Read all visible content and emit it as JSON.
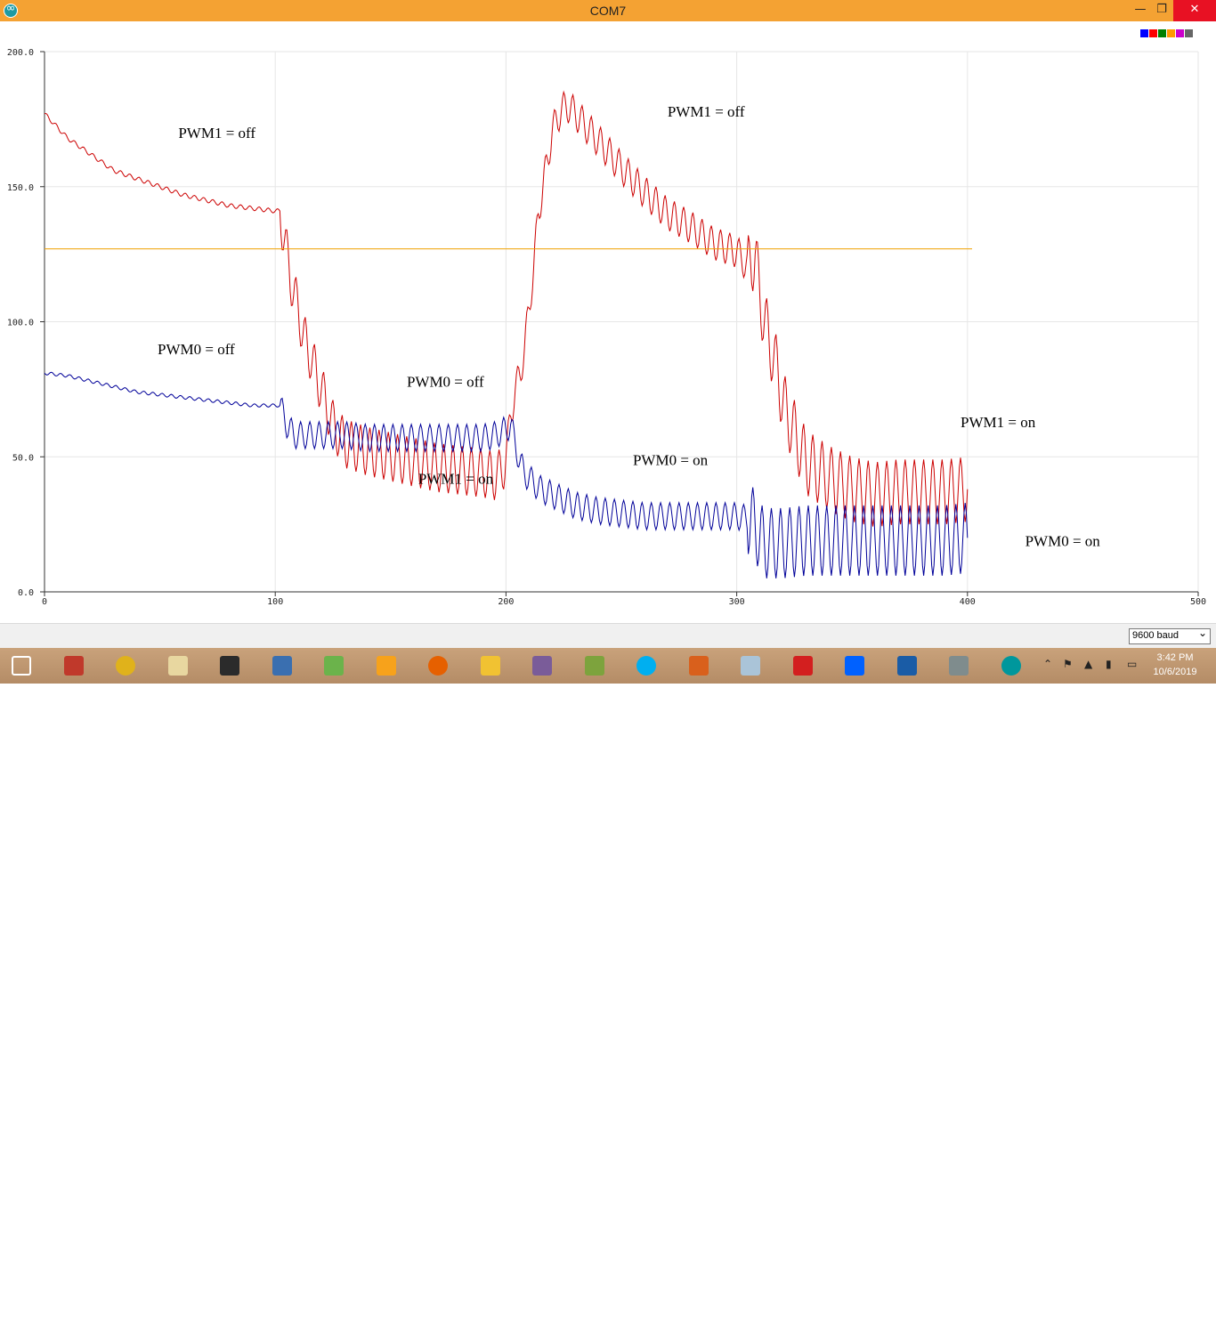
{
  "window": {
    "title": "COM7",
    "minimize": "—",
    "restore": "❐",
    "close": "✕"
  },
  "chart_data": {
    "type": "line",
    "xlim": [
      0,
      500
    ],
    "ylim": [
      0,
      200
    ],
    "xticks": [
      "0",
      "100",
      "200",
      "300",
      "400",
      "500"
    ],
    "yticks": [
      "0.0",
      "50.0",
      "100.0",
      "150.0",
      "200.0"
    ],
    "grid": true,
    "legend": "top-right",
    "colors": [
      "#0000ff",
      "#ff0000",
      "#008000",
      "#ff9900",
      "#cc00cc",
      "#666666"
    ],
    "series": [
      {
        "color": "#cc0000",
        "x": [
          0,
          10,
          20,
          30,
          40,
          50,
          60,
          70,
          80,
          90,
          100,
          102,
          105,
          108,
          110,
          112,
          115,
          118,
          120,
          125,
          130,
          140,
          150,
          160,
          170,
          180,
          190,
          195,
          198,
          200,
          202,
          204,
          206,
          208,
          210,
          212,
          214,
          216,
          218,
          220,
          222,
          224,
          226,
          228,
          230,
          235,
          240,
          250,
          260,
          270,
          280,
          290,
          300,
          305,
          308,
          310,
          312,
          315,
          318,
          320,
          330,
          340,
          350,
          360,
          370,
          380,
          390,
          400
        ],
        "y": [
          177,
          168,
          162,
          156,
          153,
          150,
          147,
          145,
          143,
          142,
          141,
          141,
          125,
          110,
          105,
          95,
          88,
          80,
          75,
          62,
          55,
          52,
          50,
          48,
          46,
          45,
          44,
          43,
          44,
          50,
          65,
          75,
          80,
          90,
          105,
          120,
          140,
          150,
          160,
          170,
          175,
          178,
          180,
          179,
          177,
          172,
          167,
          157,
          148,
          140,
          135,
          129,
          126,
          120,
          125,
          110,
          100,
          90,
          80,
          70,
          48,
          42,
          38,
          36,
          37,
          37,
          37,
          38
        ]
      },
      {
        "color": "#000099",
        "x": [
          0,
          10,
          20,
          30,
          40,
          50,
          60,
          70,
          80,
          90,
          100,
          102,
          105,
          108,
          110,
          115,
          120,
          130,
          140,
          150,
          160,
          170,
          180,
          190,
          195,
          200,
          202,
          204,
          206,
          208,
          210,
          215,
          220,
          230,
          240,
          250,
          260,
          270,
          280,
          290,
          300,
          305,
          308,
          310,
          312,
          315,
          320,
          330,
          340,
          350,
          360,
          370,
          380,
          390,
          400
        ],
        "y": [
          81,
          80,
          78,
          76,
          74,
          73,
          72,
          71,
          70,
          69,
          69,
          69,
          62,
          58,
          58,
          58,
          58,
          58,
          57,
          57,
          57,
          57,
          57,
          57,
          58,
          60,
          62,
          55,
          48,
          44,
          42,
          38,
          36,
          32,
          30,
          29,
          28,
          28,
          28,
          28,
          28,
          27,
          25,
          20,
          18,
          18,
          18,
          19,
          19,
          19,
          19,
          19,
          19,
          19,
          20
        ]
      },
      {
        "color": "#f0a000",
        "x": [
          0,
          402
        ],
        "y": [
          127,
          127
        ]
      }
    ],
    "annotations": [
      {
        "text": "PWM1 = off",
        "x": 58,
        "y": 168
      },
      {
        "text": "PWM0 = off",
        "x": 49,
        "y": 88
      },
      {
        "text": "PWM0 = off",
        "x": 157,
        "y": 76
      },
      {
        "text": "PWM1 = on",
        "x": 162,
        "y": 40
      },
      {
        "text": "PWM1 = off",
        "x": 270,
        "y": 176
      },
      {
        "text": "PWM0 = on",
        "x": 255,
        "y": 47
      },
      {
        "text": "PWM1 = on",
        "x": 397,
        "y": 61
      },
      {
        "text": "PWM0 = on",
        "x": 425,
        "y": 17
      }
    ]
  },
  "status": {
    "baud": "9600 baud"
  },
  "taskbar": {
    "apps": [
      {
        "name": "start",
        "color": "#ffffff"
      },
      {
        "name": "tex-app",
        "color": "#c0392b"
      },
      {
        "name": "chrome",
        "color": "#e0b21b"
      },
      {
        "name": "notepad",
        "color": "#e8d7a0"
      },
      {
        "name": "terminal",
        "color": "#2b2b2b"
      },
      {
        "name": "miktex",
        "color": "#3a6fb0"
      },
      {
        "name": "editor",
        "color": "#6bb34b"
      },
      {
        "name": "vi",
        "color": "#f7a21b"
      },
      {
        "name": "firefox",
        "color": "#e66000"
      },
      {
        "name": "explorer",
        "color": "#f1c232"
      },
      {
        "name": "paint",
        "color": "#7a5c99"
      },
      {
        "name": "texmaker",
        "color": "#7da33d"
      },
      {
        "name": "skype",
        "color": "#00aff0"
      },
      {
        "name": "matlab",
        "color": "#d9601c"
      },
      {
        "name": "calculator",
        "color": "#aac4d8"
      },
      {
        "name": "acrobat",
        "color": "#d31f1f"
      },
      {
        "name": "dropbox",
        "color": "#0061ff"
      },
      {
        "name": "ni",
        "color": "#1a5ca6"
      },
      {
        "name": "satellite",
        "color": "#7f8c8d"
      },
      {
        "name": "arduino",
        "color": "#00979c"
      }
    ],
    "clock_time": "3:42 PM",
    "clock_date": "10/6/2019"
  }
}
